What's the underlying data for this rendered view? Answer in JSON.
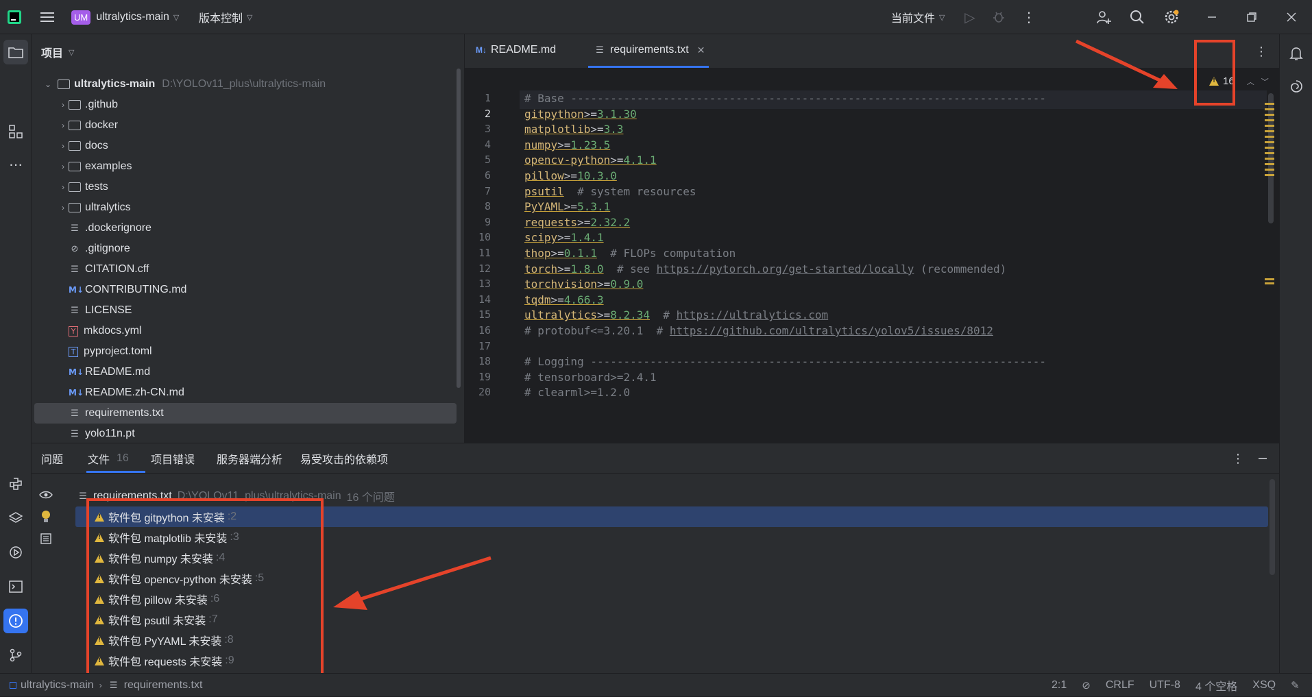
{
  "titlebar": {
    "project_badge": "UM",
    "project_name": "ultralytics-main",
    "vcs": "版本控制",
    "run_config": "当前文件"
  },
  "project_panel": {
    "title": "项目",
    "root_name": "ultralytics-main",
    "root_path": "D:\\YOLOv11_plus\\ultralytics-main",
    "items": [
      {
        "name": ".github",
        "kind": "folder"
      },
      {
        "name": "docker",
        "kind": "folder"
      },
      {
        "name": "docs",
        "kind": "folder"
      },
      {
        "name": "examples",
        "kind": "folder"
      },
      {
        "name": "tests",
        "kind": "folder"
      },
      {
        "name": "ultralytics",
        "kind": "folder"
      },
      {
        "name": ".dockerignore",
        "kind": "text"
      },
      {
        "name": ".gitignore",
        "kind": "ignore"
      },
      {
        "name": "CITATION.cff",
        "kind": "text"
      },
      {
        "name": "CONTRIBUTING.md",
        "kind": "md"
      },
      {
        "name": "LICENSE",
        "kind": "text"
      },
      {
        "name": "mkdocs.yml",
        "kind": "yml"
      },
      {
        "name": "pyproject.toml",
        "kind": "toml"
      },
      {
        "name": "README.md",
        "kind": "md"
      },
      {
        "name": "README.zh-CN.md",
        "kind": "md"
      },
      {
        "name": "requirements.txt",
        "kind": "text"
      },
      {
        "name": "yolo11n.pt",
        "kind": "text"
      }
    ],
    "selected": "requirements.txt"
  },
  "editor": {
    "tabs": [
      {
        "label": "README.md",
        "icon": "M↓"
      },
      {
        "label": "requirements.txt",
        "active": true
      }
    ],
    "warning_count": "16",
    "lines": [
      {
        "n": "1",
        "text": "# Base ------------------------------------------------------------------------"
      },
      {
        "n": "2",
        "pkg": "gitpython",
        "op": ">=",
        "ver": "3.1.30"
      },
      {
        "n": "3",
        "pkg": "matplotlib",
        "op": ">=",
        "ver": "3.3"
      },
      {
        "n": "4",
        "pkg": "numpy",
        "op": ">=",
        "ver": "1.23.5"
      },
      {
        "n": "5",
        "pkg": "opencv-python",
        "op": ">=",
        "ver": "4.1.1"
      },
      {
        "n": "6",
        "pkg": "pillow",
        "op": ">=",
        "ver": "10.3.0"
      },
      {
        "n": "7",
        "pkg": "psutil",
        "comment": "  # system resources"
      },
      {
        "n": "8",
        "pkg": "PyYAML",
        "op": ">=",
        "ver": "5.3.1"
      },
      {
        "n": "9",
        "pkg": "requests",
        "op": ">=",
        "ver": "2.32.2"
      },
      {
        "n": "10",
        "pkg": "scipy",
        "op": ">=",
        "ver": "1.4.1"
      },
      {
        "n": "11",
        "pkg": "thop",
        "op": ">=",
        "ver": "0.1.1",
        "comment": "  # FLOPs computation"
      },
      {
        "n": "12",
        "pkg": "torch",
        "op": ">=",
        "ver": "1.8.0",
        "comment": "  # see ",
        "link": "https://pytorch.org/get-started/locally",
        "after": " (recommended)"
      },
      {
        "n": "13",
        "pkg": "torchvision",
        "op": ">=",
        "ver": "0.9.0"
      },
      {
        "n": "14",
        "pkg": "tqdm",
        "op": ">=",
        "ver": "4.66.3"
      },
      {
        "n": "15",
        "pkg": "ultralytics",
        "op": ">=",
        "ver": "8.2.34",
        "comment": "  # ",
        "link": "https://ultralytics.com"
      },
      {
        "n": "16",
        "text": "# protobuf<=3.20.1  # ",
        "link": "https://github.com/ultralytics/yolov5/issues/8012"
      },
      {
        "n": "17",
        "text": ""
      },
      {
        "n": "18",
        "text": "# Logging ---------------------------------------------------------------------"
      },
      {
        "n": "19",
        "text": "# tensorboard>=2.4.1"
      },
      {
        "n": "20",
        "text": "# clearml>=1.2.0"
      }
    ]
  },
  "problems": {
    "tabs": [
      {
        "label": "问题"
      },
      {
        "label": "文件",
        "count": "16",
        "active": true
      },
      {
        "label": "项目错误"
      },
      {
        "label": "服务器端分析"
      },
      {
        "label": "易受攻击的依赖项"
      }
    ],
    "file_header": {
      "name": "requirements.txt",
      "path": "D:\\YOLOv11_plus\\ultralytics-main",
      "count_text": "16 个问题"
    },
    "items": [
      {
        "text": "软件包 gitpython 未安装",
        "line": ":2"
      },
      {
        "text": "软件包 matplotlib 未安装",
        "line": ":3"
      },
      {
        "text": "软件包 numpy 未安装",
        "line": ":4"
      },
      {
        "text": "软件包 opencv-python 未安装",
        "line": ":5"
      },
      {
        "text": "软件包 pillow 未安装",
        "line": ":6"
      },
      {
        "text": "软件包 psutil 未安装",
        "line": ":7"
      },
      {
        "text": "软件包 PyYAML 未安装",
        "line": ":8"
      },
      {
        "text": "软件包 requests 未安装",
        "line": ":9"
      }
    ]
  },
  "statusbar": {
    "crumb_project": "ultralytics-main",
    "crumb_file": "requirements.txt",
    "position": "2:1",
    "line_sep": "CRLF",
    "encoding": "UTF-8",
    "indent": "4 个空格",
    "user": "XSQ"
  },
  "colors": {
    "annotation_red": "#e5432a",
    "warning_yellow": "#e0b73e",
    "selection_blue": "#2e436e"
  }
}
